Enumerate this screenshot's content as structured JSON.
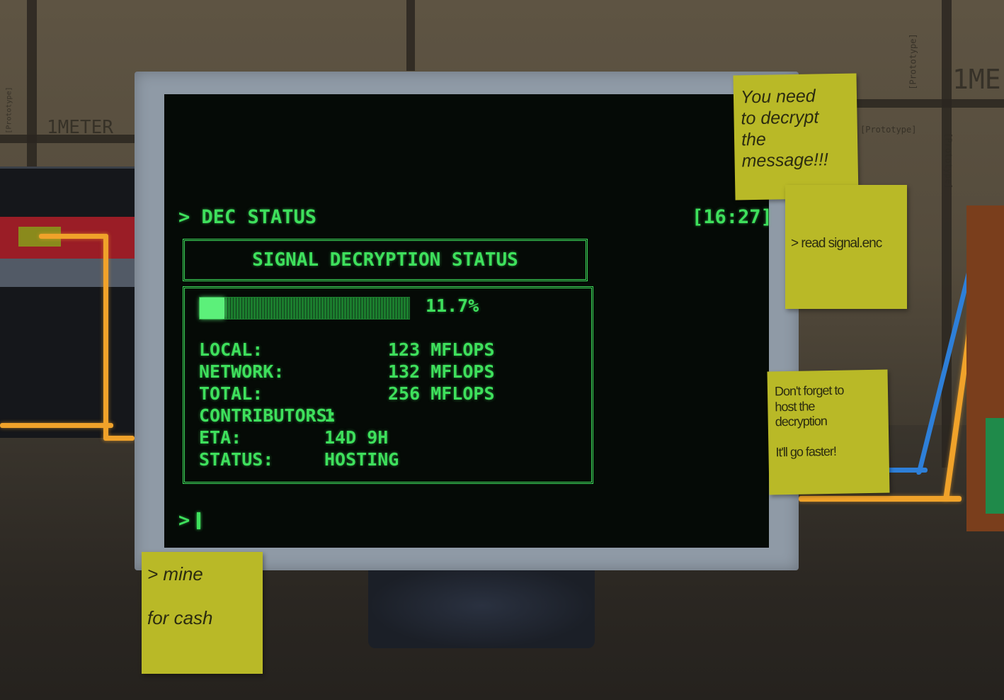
{
  "environment": {
    "wall_labels": [
      "1METER",
      "[Prototype]",
      "[Prototype]",
      "1ME",
      "[Prototype]",
      "[Prototype]"
    ]
  },
  "terminal": {
    "header_prompt": "> DEC STATUS",
    "clock": "[16:27]",
    "panel_title": "SIGNAL DECRYPTION STATUS",
    "progress_fraction": 0.117,
    "progress_label": "11.7%",
    "stats": [
      {
        "label": "LOCAL:",
        "value": "123 MFLOPS"
      },
      {
        "label": "NETWORK:",
        "value": "132 MFLOPS"
      },
      {
        "label": "TOTAL:",
        "value": "256 MFLOPS"
      },
      {
        "label": "CONTRIBUTORS:",
        "value": "1"
      },
      {
        "label": "ETA:",
        "value": "14D 9H"
      },
      {
        "label": "STATUS:",
        "value": "HOSTING"
      }
    ],
    "input_prompt": ">"
  },
  "notes": {
    "decrypt": "You need\nto decrypt\nthe\nmessage!!!",
    "read": "> read signal.enc",
    "host": "Don't forget to\nhost the\ndecryption\n\nIt'll go faster!",
    "mine": "> mine\n\n  for cash"
  },
  "colors": {
    "terminal_green": "#3ee05c",
    "note_yellow": "#b9b927",
    "cable_orange": "#f0a22a",
    "cable_blue": "#2e7fd8"
  }
}
